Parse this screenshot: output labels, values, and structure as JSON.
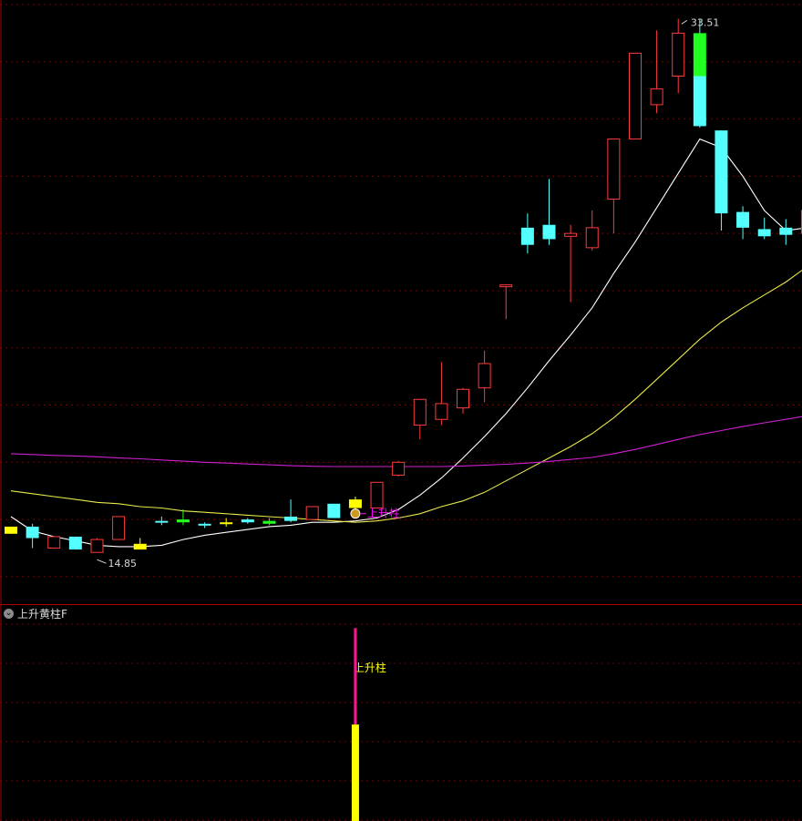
{
  "indicator_panel": {
    "title": "上升黄柱F",
    "collapse_icon": "chevron-down-icon"
  },
  "colors": {
    "background": "#000000",
    "grid": "#7a0000",
    "candle_up": "#ff3b3b",
    "candle_down": "#54ffff",
    "highlight_green": "#20ff20",
    "highlight_yellow": "#ffff00",
    "ma_white": "#ffffff",
    "ma_yellow": "#e8e84a",
    "ma_magenta": "#d020d0",
    "signal_magenta": "#ff00ff",
    "signal_stem": "#ff1493"
  },
  "chart_data": [
    {
      "type": "candlestick",
      "title": "",
      "xlabel": "",
      "ylabel": "",
      "ylim": [
        13.2,
        34.0
      ],
      "grid": true,
      "y_gridlines": [
        14.0,
        16.0,
        18.0,
        20.0,
        22.0,
        24.0,
        26.0,
        28.0,
        30.0,
        32.0,
        34.0
      ],
      "candles": [
        {
          "o": 15.75,
          "h": 15.75,
          "l": 15.5,
          "c": 15.5,
          "color": "yellow"
        },
        {
          "o": 15.75,
          "h": 15.85,
          "l": 15.0,
          "c": 15.35,
          "color": "cyan"
        },
        {
          "o": 15.0,
          "h": 15.4,
          "l": 15.0,
          "c": 15.4,
          "color": "red"
        },
        {
          "o": 15.4,
          "h": 15.4,
          "l": 14.95,
          "c": 14.95,
          "color": "cyan"
        },
        {
          "o": 14.85,
          "h": 15.35,
          "l": 14.85,
          "c": 15.3,
          "color": "red"
        },
        {
          "o": 15.3,
          "h": 16.1,
          "l": 15.3,
          "c": 16.1,
          "color": "red"
        },
        {
          "o": 15.15,
          "h": 15.35,
          "l": 15.0,
          "c": 14.95,
          "color": "yellow"
        },
        {
          "o": 15.95,
          "h": 16.1,
          "l": 15.8,
          "c": 15.95,
          "color": "cyan"
        },
        {
          "o": 16.0,
          "h": 16.35,
          "l": 15.8,
          "c": 15.9,
          "color": "green"
        },
        {
          "o": 15.85,
          "h": 15.9,
          "l": 15.7,
          "c": 15.85,
          "color": "cyan"
        },
        {
          "o": 15.85,
          "h": 16.05,
          "l": 15.75,
          "c": 15.9,
          "color": "yellow"
        },
        {
          "o": 15.9,
          "h": 16.05,
          "l": 15.85,
          "c": 16.0,
          "color": "cyan"
        },
        {
          "o": 15.95,
          "h": 16.05,
          "l": 15.8,
          "c": 15.85,
          "color": "green"
        },
        {
          "o": 15.95,
          "h": 16.7,
          "l": 15.9,
          "c": 16.1,
          "color": "cyan"
        },
        {
          "o": 16.0,
          "h": 16.45,
          "l": 16.0,
          "c": 16.45,
          "color": "red"
        },
        {
          "o": 16.55,
          "h": 16.55,
          "l": 16.05,
          "c": 16.05,
          "color": "cyan"
        },
        {
          "o": 16.4,
          "h": 16.8,
          "l": 16.3,
          "c": 16.7,
          "color": "yellow"
        },
        {
          "o": 16.4,
          "h": 17.3,
          "l": 16.4,
          "c": 17.3,
          "color": "red"
        },
        {
          "o": 17.55,
          "h": 18.05,
          "l": 17.5,
          "c": 18.0,
          "color": "red"
        },
        {
          "o": 19.3,
          "h": 20.2,
          "l": 18.8,
          "c": 20.2,
          "color": "red"
        },
        {
          "o": 19.5,
          "h": 21.5,
          "l": 19.3,
          "c": 20.05,
          "color": "red"
        },
        {
          "o": 19.9,
          "h": 20.6,
          "l": 19.7,
          "c": 20.55,
          "color": "red"
        },
        {
          "o": 20.6,
          "h": 21.9,
          "l": 20.1,
          "c": 21.45,
          "color": "red"
        },
        {
          "o": 24.2,
          "h": 24.2,
          "l": 23.0,
          "c": 24.2,
          "color": "red"
        },
        {
          "o": 26.2,
          "h": 26.7,
          "l": 25.3,
          "c": 25.6,
          "color": "cyan"
        },
        {
          "o": 26.3,
          "h": 27.9,
          "l": 25.6,
          "c": 25.8,
          "color": "cyan"
        },
        {
          "o": 25.9,
          "h": 26.3,
          "l": 23.6,
          "c": 26.0,
          "color": "red"
        },
        {
          "o": 25.5,
          "h": 26.8,
          "l": 25.4,
          "c": 26.2,
          "color": "red"
        },
        {
          "o": 27.2,
          "h": 28.6,
          "l": 26.0,
          "c": 29.3,
          "color": "red"
        },
        {
          "o": 29.3,
          "h": 32.3,
          "l": 29.3,
          "c": 32.3,
          "color": "red"
        },
        {
          "o": 30.5,
          "h": 33.1,
          "l": 30.2,
          "c": 31.05,
          "color": "red"
        },
        {
          "o": 31.5,
          "h": 33.5,
          "l": 30.9,
          "c": 33.0,
          "color": "red"
        },
        {
          "o": 33.0,
          "h": 33.51,
          "l": 29.7,
          "c": 29.75,
          "color": "cyan_green"
        },
        {
          "o": 29.6,
          "h": 29.6,
          "l": 26.1,
          "c": 26.7,
          "color": "cyan"
        },
        {
          "o": 26.75,
          "h": 26.95,
          "l": 25.8,
          "c": 26.2,
          "color": "cyan"
        },
        {
          "o": 26.15,
          "h": 26.55,
          "l": 25.8,
          "c": 25.9,
          "color": "cyan"
        },
        {
          "o": 26.2,
          "h": 26.5,
          "l": 25.6,
          "c": 25.95,
          "color": "cyan"
        },
        {
          "o": 26.0,
          "h": 27.7,
          "l": 25.6,
          "c": 26.8,
          "color": "red"
        }
      ],
      "annotations": {
        "high_label": "33.51",
        "low_label": "14.85",
        "signal_label": "上升柱"
      },
      "series": [
        {
          "kind": "ma_white",
          "values": [
            16.1,
            15.6,
            15.4,
            15.25,
            15.1,
            15.05,
            15.05,
            15.1,
            15.3,
            15.45,
            15.55,
            15.65,
            15.75,
            15.8,
            15.9,
            15.9,
            15.95,
            16.05,
            16.35,
            16.85,
            17.45,
            18.15,
            18.9,
            19.7,
            20.6,
            21.55,
            22.45,
            23.4,
            24.6,
            25.7,
            26.9,
            28.1,
            29.3,
            29.0,
            28.0,
            26.8,
            26.1,
            26.2
          ]
        },
        {
          "kind": "ma_yellow",
          "values": [
            17.0,
            16.9,
            16.8,
            16.7,
            16.6,
            16.55,
            16.45,
            16.4,
            16.3,
            16.25,
            16.2,
            16.15,
            16.1,
            16.05,
            16.0,
            15.95,
            15.9,
            15.95,
            16.05,
            16.2,
            16.45,
            16.65,
            16.95,
            17.35,
            17.75,
            18.15,
            18.55,
            19.0,
            19.55,
            20.2,
            20.9,
            21.6,
            22.3,
            22.9,
            23.4,
            23.85,
            24.3,
            24.85
          ]
        },
        {
          "kind": "ma_magenta",
          "values": [
            18.3,
            18.27,
            18.24,
            18.22,
            18.19,
            18.15,
            18.12,
            18.08,
            18.04,
            18.0,
            17.97,
            17.94,
            17.91,
            17.88,
            17.86,
            17.85,
            17.85,
            17.85,
            17.85,
            17.85,
            17.85,
            17.87,
            17.9,
            17.93,
            17.97,
            18.03,
            18.1,
            18.17,
            18.3,
            18.45,
            18.62,
            18.8,
            18.97,
            19.11,
            19.25,
            19.38,
            19.5,
            19.63
          ]
        }
      ]
    },
    {
      "type": "bar",
      "title": "上升黄柱F",
      "signal_bar_index": 16,
      "signal_bar_value": 1.0,
      "signal_stem_value": 2.0,
      "ylim": [
        0,
        2.05
      ],
      "label": "上升柱"
    }
  ]
}
